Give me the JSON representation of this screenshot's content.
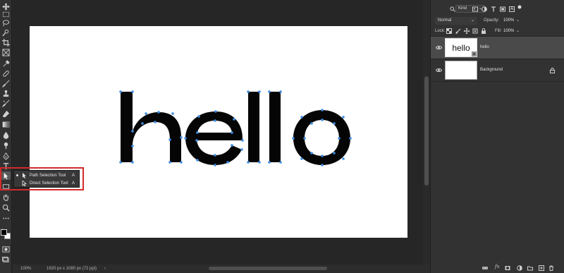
{
  "canvas": {
    "text": "hello"
  },
  "flyout": {
    "items": [
      {
        "label": "Path Selection Tool",
        "shortcut": "A",
        "selected": true
      },
      {
        "label": "Direct Selection Tool",
        "shortcut": "A",
        "selected": false
      }
    ]
  },
  "statusbar": {
    "zoom": "100%",
    "doc_info": "1920 px x 1080 px (72 ppi)",
    "arrow": "›"
  },
  "panel": {
    "filter_label": "Kind",
    "blend_mode": "Normal",
    "opacity_label": "Opacity:",
    "opacity_value": "100%",
    "lock_label": "Lock:",
    "fill_label": "Fill:",
    "fill_value": "100%",
    "layers": [
      {
        "name": "hello",
        "thumb_text": "hello",
        "selected": true,
        "locked": false
      },
      {
        "name": "Background",
        "thumb_text": "",
        "selected": false,
        "locked": true
      }
    ]
  },
  "colors": {
    "highlight_border": "#d22a2a",
    "anchor_point": "#3d8ee0"
  }
}
